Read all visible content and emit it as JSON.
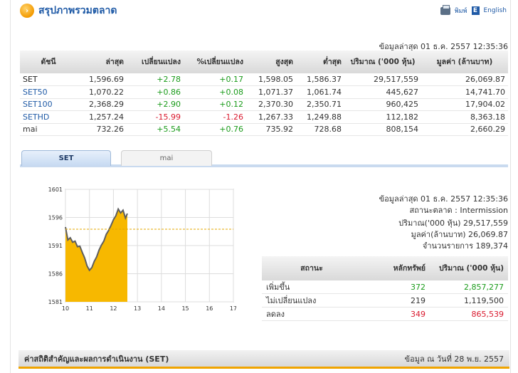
{
  "header": {
    "title": "สรุปภาพรวมตลาด",
    "print_label": "พิมพ์",
    "english_label": "English"
  },
  "summary": {
    "updated": "ข้อมูลล่าสุด 01 ธ.ค. 2557 12:35:36",
    "columns": [
      "ดัชนี",
      "ล่าสุด",
      "เปลี่ยนแปลง",
      "%เปลี่ยนแปลง",
      "สูงสุด",
      "ต่ำสุด",
      "ปริมาณ ('000 หุ้น)",
      "มูลค่า (ล้านบาท)"
    ],
    "rows": [
      {
        "name": "SET",
        "last": "1,596.69",
        "chg": "+2.78",
        "pct": "+0.17",
        "high": "1,598.05",
        "low": "1,586.37",
        "vol": "29,517,559",
        "val": "26,069.87",
        "dir": "pos"
      },
      {
        "name": "SET50",
        "last": "1,070.22",
        "chg": "+0.86",
        "pct": "+0.08",
        "high": "1,071.37",
        "low": "1,061.74",
        "vol": "445,627",
        "val": "14,741.70",
        "dir": "pos"
      },
      {
        "name": "SET100",
        "last": "2,368.29",
        "chg": "+2.90",
        "pct": "+0.12",
        "high": "2,370.30",
        "low": "2,350.71",
        "vol": "960,425",
        "val": "17,904.02",
        "dir": "pos"
      },
      {
        "name": "SETHD",
        "last": "1,257.24",
        "chg": "-15.99",
        "pct": "-1.26",
        "high": "1,267.33",
        "low": "1,249.88",
        "vol": "112,182",
        "val": "8,363.18",
        "dir": "neg"
      },
      {
        "name": "mai",
        "last": "732.26",
        "chg": "+5.54",
        "pct": "+0.76",
        "high": "735.92",
        "low": "728.68",
        "vol": "808,154",
        "val": "2,660.29",
        "dir": "pos"
      }
    ]
  },
  "tabs": {
    "set": "SET",
    "mai": "mai"
  },
  "chart_data": {
    "type": "area",
    "y_ticks": [
      "1601",
      "1596",
      "1591",
      "1586",
      "1581"
    ],
    "x_ticks": [
      "10",
      "11",
      "12",
      "13",
      "14",
      "15",
      "16",
      "17"
    ],
    "ylim": [
      1581,
      1601
    ],
    "xlim": [
      10,
      17
    ],
    "reference_line": 1593.91,
    "x": [
      10.0,
      10.1,
      10.2,
      10.3,
      10.4,
      10.5,
      10.6,
      10.7,
      10.8,
      10.9,
      11.0,
      11.1,
      11.2,
      11.3,
      11.4,
      11.5,
      11.6,
      11.7,
      11.8,
      11.9,
      12.0,
      12.1,
      12.2,
      12.3,
      12.4,
      12.5,
      12.58
    ],
    "values": [
      1594.3,
      1592.0,
      1592.4,
      1591.6,
      1591.8,
      1590.8,
      1590.9,
      1589.8,
      1588.8,
      1587.4,
      1586.6,
      1587.1,
      1588.2,
      1589.0,
      1590.2,
      1591.1,
      1591.8,
      1593.0,
      1593.7,
      1594.6,
      1595.6,
      1596.3,
      1597.5,
      1596.8,
      1597.3,
      1595.9,
      1596.7
    ],
    "fill_color": "#f7b800",
    "line_color": "#5e5e5e"
  },
  "stats": {
    "updated": "ข้อมูลล่าสุด 01 ธ.ค. 2557 12:35:36",
    "market_status": "สถานะตลาด : Intermission",
    "volume": "ปริมาณ('000 หุ้น) 29,517,559",
    "value": "มูลค่า(ล้านบาท) 26,069.87",
    "deals": "จำนวนรายการ 189,374"
  },
  "advances": {
    "columns": [
      "สถานะ",
      "หลักทรัพย์",
      "ปริมาณ ('000 หุ้น)"
    ],
    "rows": [
      {
        "label": "เพิ่มขึ้น",
        "count": "372",
        "vol": "2,857,277",
        "dir": "pos"
      },
      {
        "label": "ไม่เปลี่ยนแปลง",
        "count": "219",
        "vol": "1,119,500",
        "dir": "flat"
      },
      {
        "label": "ลดลง",
        "count": "349",
        "vol": "865,539",
        "dir": "neg"
      }
    ]
  },
  "footer": {
    "title": "ค่าสถิติสำคัญและผลการดำเนินงาน (SET)",
    "date": "ข้อมูล ณ วันที่ 28 พ.ย. 2557"
  },
  "colors": {
    "accent": "#1f5aa6",
    "positive": "#1a9b1a",
    "negative": "#d9182d",
    "highlight": "#f0a400"
  }
}
